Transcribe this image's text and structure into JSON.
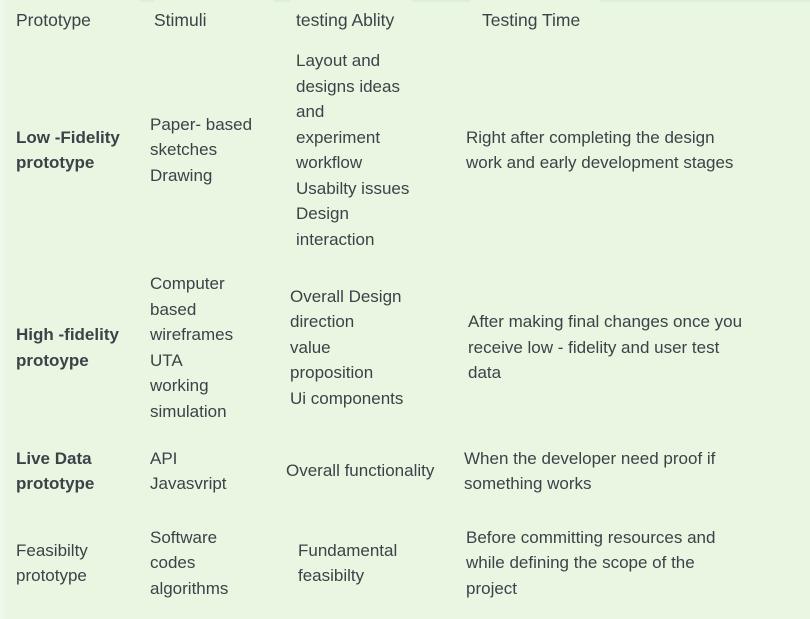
{
  "table": {
    "background_color": "#e9f6e2",
    "text_color": "#3d4248",
    "headers": {
      "col1": "Prototype",
      "col2": "Stimuli",
      "col3": "testing Ablity",
      "col4": "Testing Time"
    },
    "rows": [
      {
        "prototype": "Low -Fidelity\nprototype",
        "prototype_bold": true,
        "stimuli": "Paper- based\nsketches\nDrawing",
        "testing_ability": "Layout and\ndesigns ideas\nand\nexperiment\nworkflow\nUsabilty issues\nDesign\ninteraction",
        "testing_time": "Right after completing the design\nwork and early development stages"
      },
      {
        "prototype": "High -fidelity\nprotoype",
        "prototype_bold": true,
        "stimuli": "Computer\nbased\nwireframes\nUTA\nworking\nsimulation",
        "testing_ability": "Overall Design\ndirection\nvalue\nproposition\nUi components",
        "testing_time": "After making final changes once you\nreceive low - fidelity and user test\ndata"
      },
      {
        "prototype": "Live Data\nprototype",
        "prototype_bold": true,
        "stimuli": "API\nJavasvript",
        "testing_ability": "Overall functionality",
        "testing_time": "When the developer need proof if\nsomething works"
      },
      {
        "prototype": "Feasibilty\nprototype",
        "prototype_bold": false,
        "stimuli": "Software\ncodes\nalgorithms",
        "testing_ability": "Fundamental\nfeasibilty",
        "testing_time": "Before committing resources and\nwhile defining the scope of the\nproject"
      }
    ]
  }
}
